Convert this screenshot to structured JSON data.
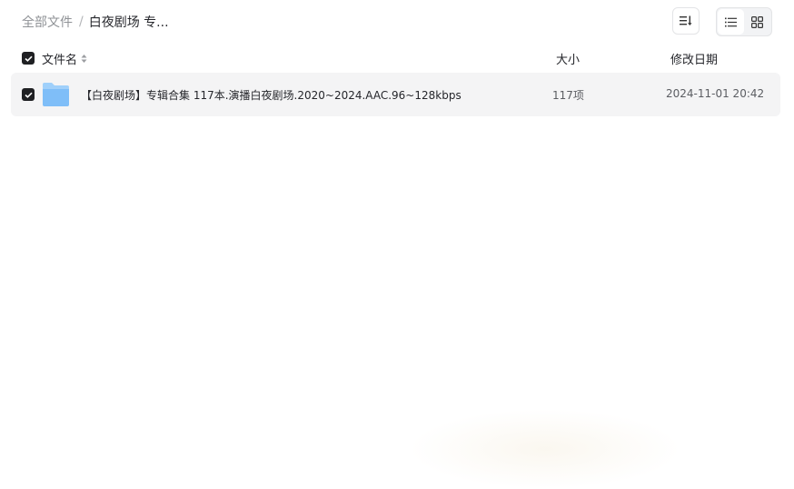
{
  "breadcrumb": {
    "root": "全部文件",
    "separator": "/",
    "current": "白夜剧场 专..."
  },
  "toolbar": {
    "sort_icon": "sort-order-icon",
    "view_list_icon": "list-view-icon",
    "view_grid_icon": "grid-view-icon",
    "active_view": "list"
  },
  "table": {
    "columns": {
      "name": "文件名",
      "size": "大小",
      "date": "修改日期"
    },
    "rows": [
      {
        "name": "【白夜剧场】专辑合集 117本.演播白夜剧场.2020~2024.AAC.96~128kbps",
        "size": "117项",
        "date": "2024-11-01 20:42",
        "icon": "folder-icon",
        "checked": true
      }
    ]
  },
  "colors": {
    "folder_top": "#9fd0fb",
    "folder_body": "#7fbef8",
    "checkbox": "#1f2023",
    "row_bg": "#f4f4f5"
  }
}
